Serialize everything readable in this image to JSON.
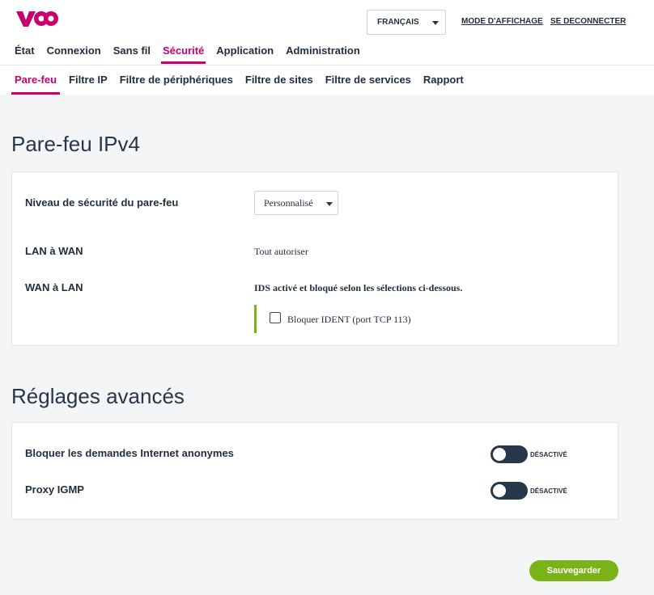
{
  "brand": {
    "logo_alt": "voo",
    "color": "#c8006e",
    "accent_green": "#7ab317"
  },
  "header": {
    "language": "FRANÇAIS",
    "display_mode": "MODE D'AFFICHAGE",
    "logout": "SE DECONNECTER"
  },
  "main_nav": [
    {
      "label": "État",
      "active": false
    },
    {
      "label": "Connexion",
      "active": false
    },
    {
      "label": "Sans fil",
      "active": false
    },
    {
      "label": "Sécurité",
      "active": true
    },
    {
      "label": "Application",
      "active": false
    },
    {
      "label": "Administration",
      "active": false
    }
  ],
  "sub_nav": [
    {
      "label": "Pare-feu",
      "active": true
    },
    {
      "label": "Filtre IP",
      "active": false
    },
    {
      "label": "Filtre de périphériques",
      "active": false
    },
    {
      "label": "Filtre de sites",
      "active": false
    },
    {
      "label": "Filtre de services",
      "active": false
    },
    {
      "label": "Rapport",
      "active": false
    }
  ],
  "firewall": {
    "title": "Pare-feu IPv4",
    "security_level_label": "Niveau de sécurité du pare-feu",
    "security_level_value": "Personnalisé",
    "lan_wan_label": "LAN à WAN",
    "lan_wan_value": "Tout autoriser",
    "wan_lan_label": "WAN à LAN",
    "wan_lan_value": "IDS activé et bloqué selon les sélections ci-dessous.",
    "block_ident_label": "Bloquer IDENT (port TCP 113)",
    "block_ident_checked": false
  },
  "advanced": {
    "title": "Réglages avancés",
    "block_anonymous_label": "Bloquer les demandes Internet anonymes",
    "block_anonymous_state": "DÉSACTIVÉ",
    "igmp_proxy_label": "Proxy IGMP",
    "igmp_proxy_state": "DÉSACTIVÉ"
  },
  "actions": {
    "save": "Sauvegarder"
  }
}
